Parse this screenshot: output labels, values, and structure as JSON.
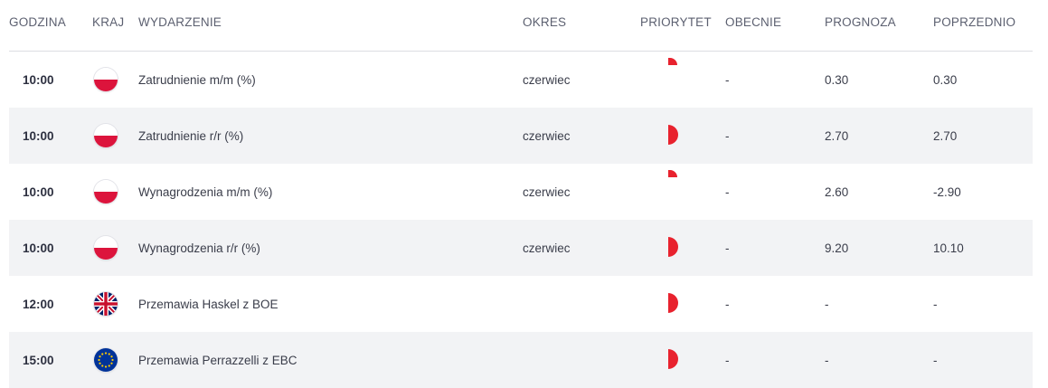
{
  "headers": {
    "time": "GODZINA",
    "country": "KRAJ",
    "event": "WYDARZENIE",
    "period": "OKRES",
    "priority": "PRIORYTET",
    "actual": "OBECNIE",
    "forecast": "PROGNOZA",
    "previous": "POPRZEDNIO"
  },
  "colors": {
    "priority": "#e8222e",
    "row_alt": "#f2f3f5",
    "header_text": "#5c6070"
  },
  "rows": [
    {
      "time": "10:00",
      "flag": "poland-flag-icon",
      "event": "Zatrudnienie m/m (%)",
      "period": "czerwiec",
      "priority": "low",
      "actual": "-",
      "forecast": "0.30",
      "previous": "0.30"
    },
    {
      "time": "10:00",
      "flag": "poland-flag-icon",
      "event": "Zatrudnienie r/r (%)",
      "period": "czerwiec",
      "priority": "medium",
      "actual": "-",
      "forecast": "2.70",
      "previous": "2.70"
    },
    {
      "time": "10:00",
      "flag": "poland-flag-icon",
      "event": "Wynagrodzenia m/m (%)",
      "period": "czerwiec",
      "priority": "low",
      "actual": "-",
      "forecast": "2.60",
      "previous": "-2.90"
    },
    {
      "time": "10:00",
      "flag": "poland-flag-icon",
      "event": "Wynagrodzenia r/r (%)",
      "period": "czerwiec",
      "priority": "medium",
      "actual": "-",
      "forecast": "9.20",
      "previous": "10.10"
    },
    {
      "time": "12:00",
      "flag": "uk-flag-icon",
      "event": "Przemawia Haskel z BOE",
      "period": "",
      "priority": "medium",
      "actual": "-",
      "forecast": "-",
      "previous": "-"
    },
    {
      "time": "15:00",
      "flag": "eu-flag-icon",
      "event": "Przemawia Perrazzelli z EBC",
      "period": "",
      "priority": "medium",
      "actual": "-",
      "forecast": "-",
      "previous": "-"
    }
  ]
}
